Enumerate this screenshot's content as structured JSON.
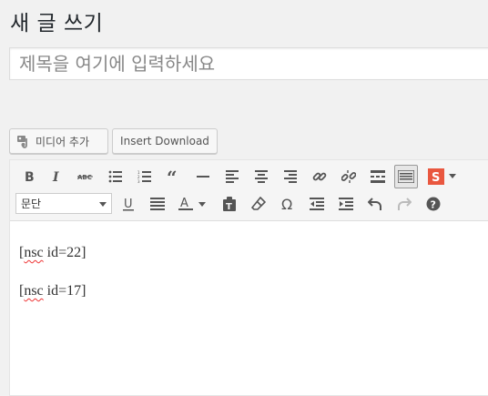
{
  "page": {
    "title": "새 글 쓰기"
  },
  "title_field": {
    "value": "",
    "placeholder": "제목을 여기에 입력하세요"
  },
  "media_buttons": {
    "add_media": "미디어 추가",
    "insert_download": "Insert Download"
  },
  "toolbar": {
    "row1_icons": [
      "bold-icon",
      "italic-icon",
      "strikethrough-icon",
      "bullet-list-icon",
      "numbered-list-icon",
      "blockquote-icon",
      "horizontal-rule-icon",
      "align-left-icon",
      "align-center-icon",
      "align-right-icon",
      "link-icon",
      "unlink-icon",
      "read-more-icon",
      "toolbar-toggle-icon",
      "s-plugin-icon",
      "dropdown-arrow-icon"
    ],
    "format_select": "문단",
    "row2_icons": [
      "underline-icon",
      "justify-icon",
      "text-color-icon",
      "paste-text-icon",
      "clear-formatting-icon",
      "special-character-icon",
      "outdent-icon",
      "indent-icon",
      "undo-icon",
      "redo-icon",
      "help-icon"
    ],
    "plugin_letter": "S",
    "plugin_color": "#e9573f"
  },
  "content": {
    "lines": [
      {
        "prefix": "[",
        "word": "nsc",
        "rest": " id=22]"
      },
      {
        "prefix": "[",
        "word": "nsc",
        "rest": " id=17]"
      }
    ]
  }
}
